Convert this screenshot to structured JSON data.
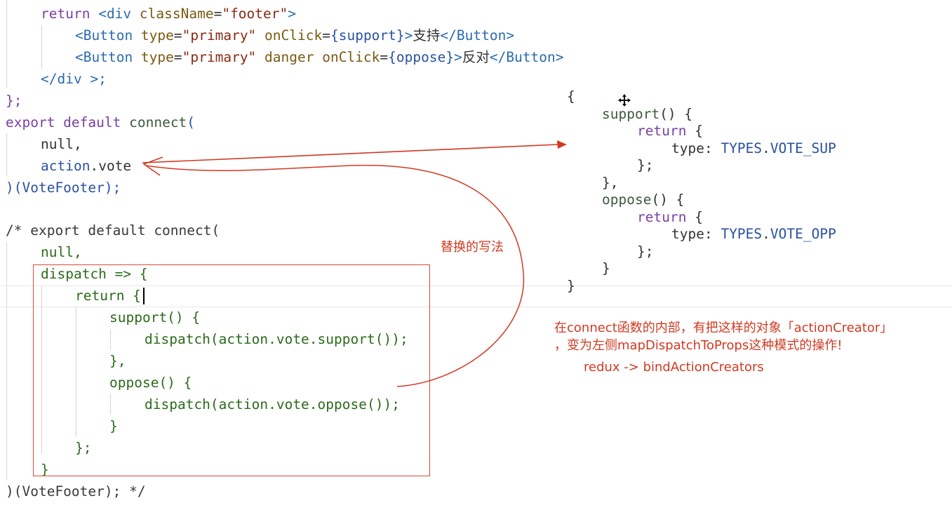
{
  "code_top": {
    "l1_ret": "return",
    "l1_tag": "<div",
    "l1_attr": " className",
    "l1_eq": "=",
    "l1_str": "\"footer\"",
    "l1_end": ">",
    "l2_tag": "<Button",
    "l2_attr": " type",
    "l2_str": "\"primary\"",
    "l2_attr2": " onClick",
    "l2_expr": "{support}",
    "l2_gt": ">",
    "l2_text": "支持",
    "l2_close": "</Button>",
    "l3_tag": "<Button",
    "l3_attr": " type",
    "l3_str": "\"primary\"",
    "l3_attr2": " danger onClick",
    "l3_expr": "{oppose}",
    "l3_gt": ">",
    "l3_text": "反对",
    "l3_close": "</Button>",
    "l4": "</div >;",
    "l5": "};",
    "l6_kw": "export default",
    "l6_fn": " connect",
    "l6_p": "(",
    "l7": "null,",
    "l8_obj": "action",
    "l8_dot": ".",
    "l8_prop": "vote",
    "l9": ")(VoteFooter);"
  },
  "code_comment": {
    "c1": "/* export default connect(",
    "c2": "null,",
    "c3": "dispatch => {",
    "c4": "return {",
    "c5": "support() {",
    "c6": "dispatch(action.vote.support());",
    "c7": "},",
    "c8": "oppose() {",
    "c9": "dispatch(action.vote.oppose());",
    "c10": "}",
    "c11": "};",
    "c12": "}",
    "c13": ")(VoteFooter); */"
  },
  "right_code": {
    "r1": "{",
    "r2_fn": "support",
    "r2_rest": "() {",
    "r3_kw": "return",
    "r3_rest": " {",
    "r4_key": "type:",
    "r4_obj": "TYPES",
    "r4_dot": ".",
    "r4_prop": "VOTE_SUP",
    "r5": "};",
    "r6": "},",
    "r7_fn": "oppose",
    "r7_rest": "() {",
    "r8_kw": "return",
    "r8_rest": " {",
    "r9_key": "type:",
    "r9_obj": "TYPES",
    "r9_dot": ".",
    "r9_prop": "VOTE_OPP",
    "r10": "};",
    "r11": "}",
    "r12": "}"
  },
  "annotations": {
    "replace_label": "替换的写法",
    "note_line1": "在connect函数的内部，有把这样的对象「actionCreator」",
    "note_line2": "，变为左侧mapDispatchToProps这种模式的操作!",
    "note_line3": "redux -> bindActionCreators"
  },
  "colors": {
    "annotation_red": "#d03a22",
    "keyword_purple": "#7b3fa0",
    "tag_blue": "#2a6bb0",
    "property_blue": "#2a52a0",
    "green_text": "#2a6b1a"
  },
  "icons": {
    "move_cursor": "move-cursor-icon"
  }
}
